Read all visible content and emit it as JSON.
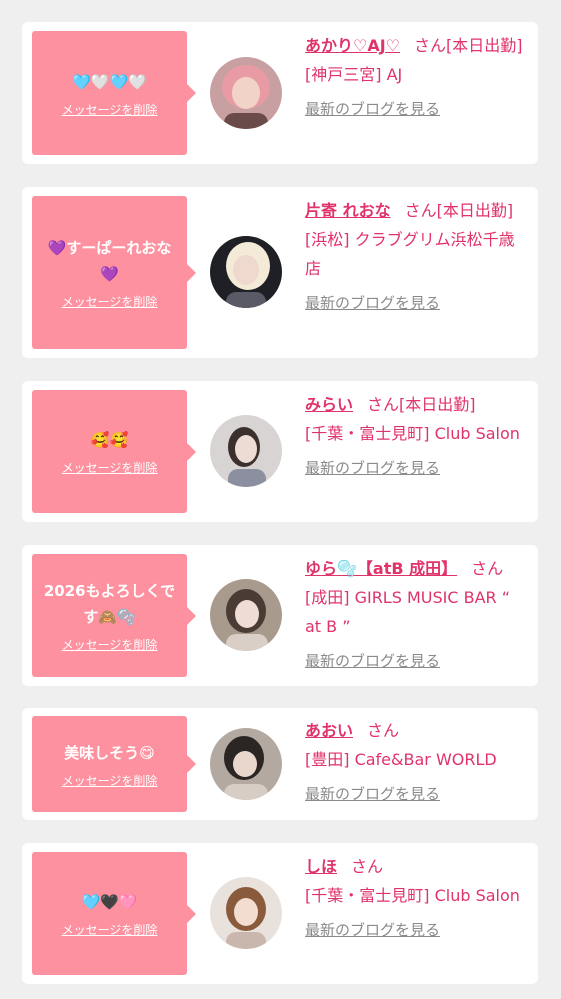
{
  "cards": [
    {
      "message": "🩵🤍🩵🤍",
      "delete_label": "メッセージを削除",
      "name": "あかり♡AJ♡",
      "honorific": "さん",
      "attendance": "[本日出勤]",
      "shop": "[神戸三宮] AJ",
      "blog_label": "最新のブログを見る",
      "avatar": {
        "bg": "#c9a0a2",
        "skin": "#f2d3c7",
        "hair": "#e89ba4",
        "accent": "#6b4a4a"
      }
    },
    {
      "message": "💜すーぱーれおな💜",
      "delete_label": "メッセージを削除",
      "name": "片寄 れおな",
      "honorific": "さん",
      "attendance": "[本日出勤]",
      "shop": "[浜松] クラブグリム浜松千歳店",
      "blog_label": "最新のブログを見る",
      "avatar": {
        "bg": "#1f1f26",
        "skin": "#efd8cd",
        "hair": "#f4ead8",
        "accent": "#5a5a66"
      }
    },
    {
      "message": "🥰🥰",
      "delete_label": "メッセージを削除",
      "name": "みらい",
      "honorific": "さん",
      "attendance": "[本日出勤]",
      "shop": "[千葉・富士見町] Club Salon",
      "blog_label": "最新のブログを見る",
      "avatar": {
        "bg": "#d8d4d3",
        "skin": "#eddcd3",
        "hair": "#3b302d",
        "accent": "#8b8fa0"
      }
    },
    {
      "message": "2026もよろしくです🙈🫧",
      "delete_label": "メッセージを削除",
      "name": "ゆら🫧【atB 成田】",
      "honorific": "さん",
      "attendance": "",
      "shop": "[成田] GIRLS MUSIC BAR “ at B ”",
      "blog_label": "最新のブログを見る",
      "avatar": {
        "bg": "#a89a8d",
        "skin": "#efddd5",
        "hair": "#4a3c35",
        "accent": "#d9cfc6"
      }
    },
    {
      "message": "美味しそう😋",
      "delete_label": "メッセージを削除",
      "name": "あおい",
      "honorific": "さん",
      "attendance": "",
      "shop": "[豊田] Cafe&Bar WORLD",
      "blog_label": "最新のブログを見る",
      "avatar": {
        "bg": "#b3a9a0",
        "skin": "#e9d6cc",
        "hair": "#2b2624",
        "accent": "#d7cdc4"
      }
    },
    {
      "message": "🩵🖤🩷",
      "delete_label": "メッセージを削除",
      "name": "しほ",
      "honorific": "さん",
      "attendance": "",
      "shop": "[千葉・富士見町] Club Salon",
      "blog_label": "最新のブログを見る",
      "avatar": {
        "bg": "#e9e2dc",
        "skin": "#f3ddd1",
        "hair": "#8a5a3c",
        "accent": "#c9b7ad"
      }
    }
  ]
}
